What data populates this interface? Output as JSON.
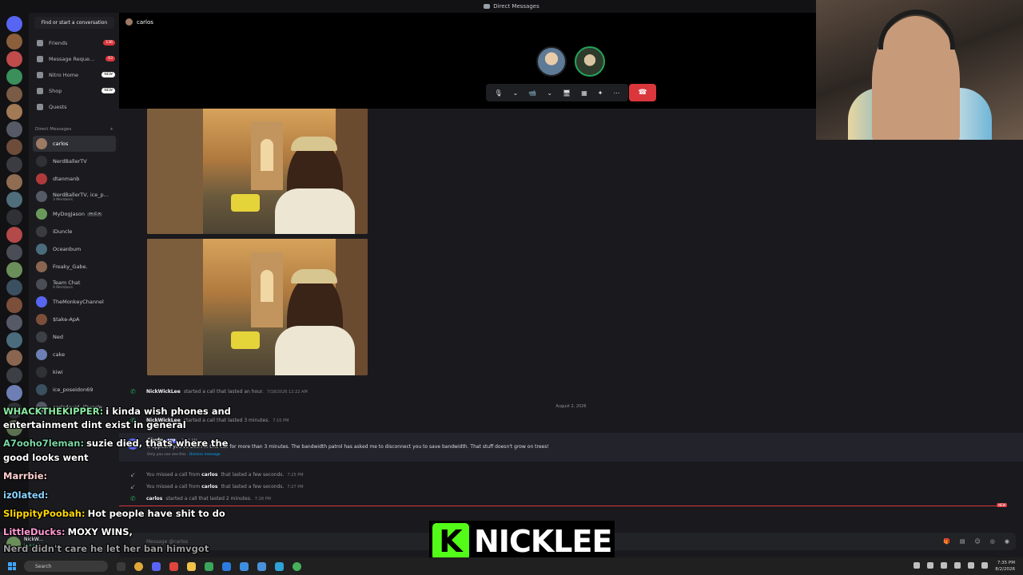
{
  "window": {
    "title": "Direct Messages"
  },
  "sidebar": {
    "find_placeholder": "Find or start a conversation",
    "nav": [
      {
        "label": "Friends",
        "badge": "136"
      },
      {
        "label": "Message Reque...",
        "badge": "63"
      },
      {
        "label": "Nitro Home",
        "badge": "NEW"
      },
      {
        "label": "Shop",
        "badge": "NEW"
      },
      {
        "label": "Quests",
        "badge": ""
      }
    ],
    "dm_header": "Direct Messages",
    "dm_add": "+",
    "dms": [
      {
        "name": "carlos",
        "sub": "",
        "tag": "",
        "color": "#9c7a63"
      },
      {
        "name": "NerdBallerTV",
        "sub": "",
        "tag": "",
        "color": "#2f3136"
      },
      {
        "name": "dtanmanb",
        "sub": "",
        "tag": "",
        "color": "#b03a3a"
      },
      {
        "name": "NerdBallerTV, ice_p...",
        "sub": "3 Members",
        "tag": "",
        "color": "#555a66"
      },
      {
        "name": "MyDogJason",
        "sub": "",
        "tag": "🎮 C ✕",
        "color": "#6a9a5b"
      },
      {
        "name": "iDuncle",
        "sub": "",
        "tag": "",
        "color": "#3b3c42"
      },
      {
        "name": "Oceanbum",
        "sub": "",
        "tag": "",
        "color": "#4a6c7d"
      },
      {
        "name": "Freaky_Gabe.",
        "sub": "",
        "tag": "",
        "color": "#8a6650"
      },
      {
        "name": "Team Chat",
        "sub": "9 Members",
        "tag": "",
        "color": "#4a4d55"
      },
      {
        "name": "TheMonkeyChannel",
        "sub": "",
        "tag": "",
        "color": "#5865f2"
      },
      {
        "name": "$take-ApA",
        "sub": "",
        "tag": "",
        "color": "#7c4f3a"
      },
      {
        "name": "Ned",
        "sub": "",
        "tag": "",
        "color": "#3c3f45"
      },
      {
        "name": "cake",
        "sub": "",
        "tag": "",
        "color": "#6d7fb5"
      },
      {
        "name": "kiwi",
        "sub": "",
        "tag": "",
        "color": "#2f3136"
      },
      {
        "name": "ice_poseidon69",
        "sub": "",
        "tag": "",
        "color": "#3a5060"
      },
      {
        "name": "carlsdavid, iDuncle",
        "sub": "",
        "tag": "",
        "color": "#555a66"
      }
    ]
  },
  "call": {
    "name": "carlos",
    "controls": [
      "🎙",
      "⌄",
      "📹",
      "⌄",
      "🖥",
      "▦",
      "✦",
      "⋯"
    ],
    "hangup": "☎"
  },
  "messages": {
    "call1": {
      "user": "NickWickLee",
      "text": "started a call that lasted an hour.",
      "ts": "7/18/2026 12:22 AM"
    },
    "date_sep": "August 2, 2026",
    "call2": {
      "user": "NickWickLee",
      "text": "started a call that lasted 3 minutes.",
      "ts": "7:10 PM"
    },
    "clyde": {
      "name": "Clyde",
      "app": "APP",
      "ts": "7:13 PM",
      "text": "It appears you've been in this call for more than 3 minutes. The bandwidth patrol has asked me to disconnect you to save bandwidth. That stuff doesn't grow on trees!",
      "only": "Only you can see this ·",
      "dismiss": "Dismiss message"
    },
    "missed1": {
      "pre": "You missed a call from",
      "user": "carlos",
      "post": "that lasted a few seconds.",
      "ts": "7:25 PM"
    },
    "missed2": {
      "pre": "You missed a call from",
      "user": "carlos",
      "post": "that lasted a few seconds.",
      "ts": "7:27 PM"
    },
    "call3": {
      "user": "carlos",
      "text": "started a call that lasted 2 minutes.",
      "ts": "7:28 PM"
    },
    "new_tag": "NEW",
    "composer_placeholder": "Message @carlos",
    "composer_tools": [
      "🎁",
      "▤",
      "☺",
      "◎",
      "◉"
    ]
  },
  "user_panel": {
    "name": "NickW...",
    "status": "In a call"
  },
  "chat_overlay": [
    {
      "user": "WHACKTHEKIPPER:",
      "text": "i kinda wish phones and",
      "color": "#8be9a2"
    },
    {
      "user": "",
      "text": "entertainment dint exist in general",
      "color": "#ffffff"
    },
    {
      "user": "A7ooho7leman:",
      "text": "suzie died, thats where the",
      "color": "#7ad6a5"
    },
    {
      "user": "",
      "text": "good looks went",
      "color": "#ffffff"
    },
    {
      "user": "Marrbie:",
      "text": "",
      "color": "#ffd0d0"
    },
    {
      "user": "iz0lated:",
      "text": "",
      "color": "#8bd3ff"
    },
    {
      "user": "SlippityPoobah:",
      "text": "Hot people have shit to do",
      "color": "#ffd700"
    },
    {
      "user": "LittleDucks:",
      "text": "MOXY WINS,",
      "color": "#ff9ad5"
    },
    {
      "user": "",
      "text": "Nerd didn't care he let her ban himvgot",
      "color": "#ffffff"
    }
  ],
  "brand": {
    "logo": "K",
    "text": "NICKLEE"
  },
  "taskbar": {
    "search": "Search",
    "time": "7:35 PM",
    "date": "8/2/2026"
  }
}
